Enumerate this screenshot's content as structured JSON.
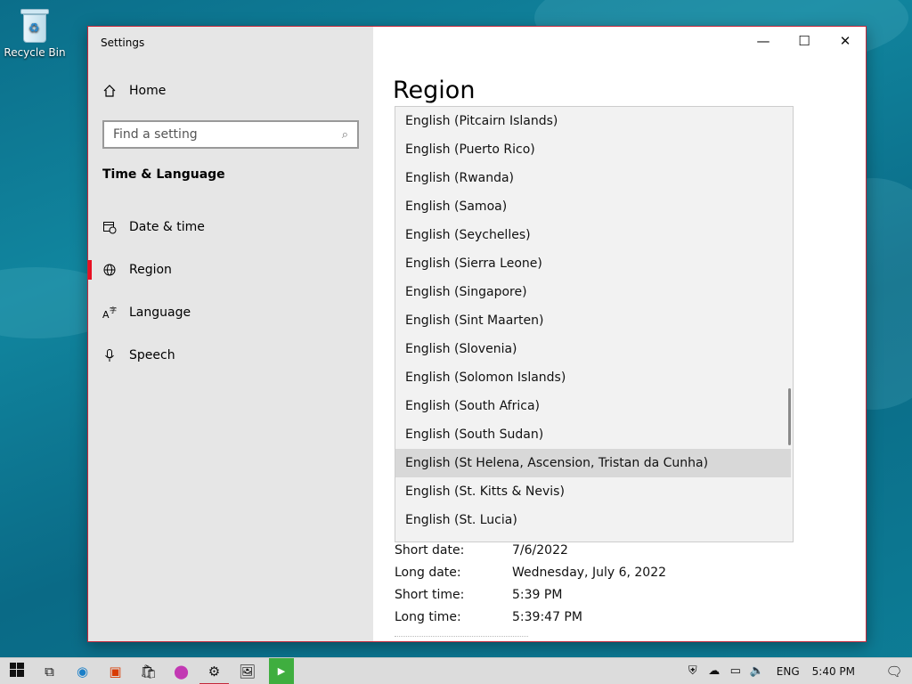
{
  "desktop": {
    "recycle_bin_label": "Recycle Bin"
  },
  "window": {
    "title": "Settings",
    "controls": {
      "minimize": "—",
      "maximize": "☐",
      "close": "✕"
    }
  },
  "sidebar": {
    "home_label": "Home",
    "search_placeholder": "Find a setting",
    "section_title": "Time & Language",
    "items": [
      {
        "label": "Date & time",
        "icon": "calendar-clock-icon"
      },
      {
        "label": "Region",
        "icon": "globe-icon",
        "active": true
      },
      {
        "label": "Language",
        "icon": "language-icon"
      },
      {
        "label": "Speech",
        "icon": "microphone-icon"
      }
    ]
  },
  "main": {
    "page_title": "Region",
    "region_options": [
      "English (Pitcairn Islands)",
      "English (Puerto Rico)",
      "English (Rwanda)",
      "English (Samoa)",
      "English (Seychelles)",
      "English (Sierra Leone)",
      "English (Singapore)",
      "English (Sint Maarten)",
      "English (Slovenia)",
      "English (Solomon Islands)",
      "English (South Africa)",
      "English (South Sudan)",
      "English (St Helena, Ascension, Tristan da Cunha)",
      "English (St. Kitts & Nevis)",
      "English (St. Lucia)"
    ],
    "selected_index": 12,
    "formats": [
      {
        "label": "Short date:",
        "value": "7/6/2022"
      },
      {
        "label": "Long date:",
        "value": "Wednesday, July 6, 2022"
      },
      {
        "label": "Short time:",
        "value": "5:39 PM"
      },
      {
        "label": "Long time:",
        "value": "5:39:47 PM"
      }
    ]
  },
  "taskbar": {
    "language": "ENG",
    "time": "5:40 PM"
  },
  "colors": {
    "accent": "#e81123",
    "window_border": "#c4283a",
    "desktop": "#0b6e8a"
  }
}
